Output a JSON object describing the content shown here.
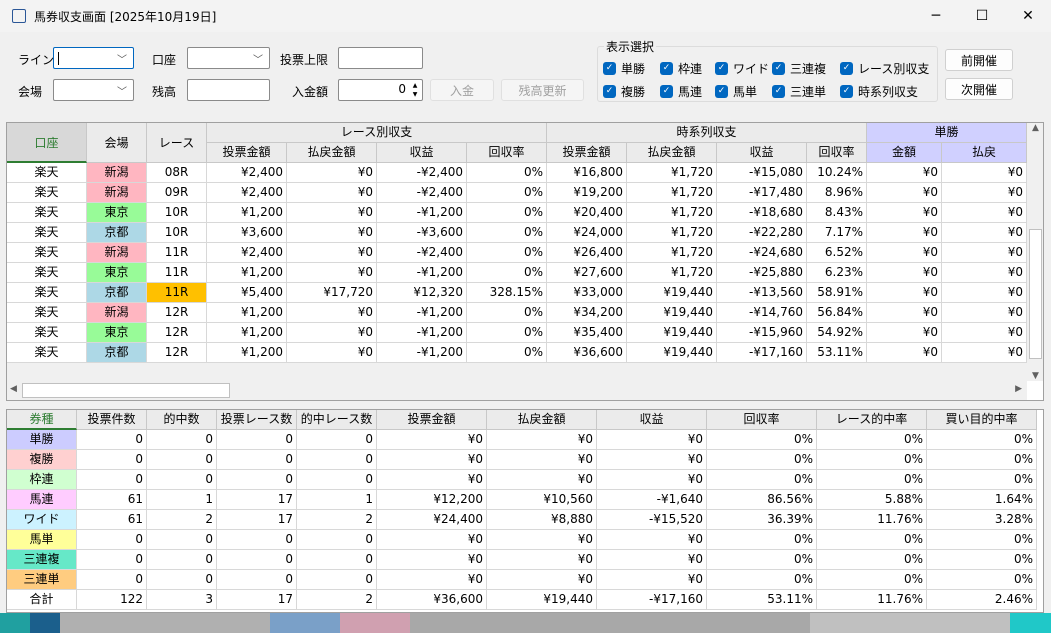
{
  "window": {
    "title": "馬券収支画面 [2025年10月19日]",
    "minimize": "─",
    "maximize": "☐",
    "close": "✕"
  },
  "form": {
    "line_label": "ライン",
    "line_value": "",
    "account_label": "口座",
    "account_value": "",
    "limit_label": "投票上限",
    "limit_value": "",
    "venue_label": "会場",
    "venue_value": "",
    "balance_label": "残高",
    "balance_value": "",
    "deposit_label": "入金額",
    "deposit_value": "0",
    "deposit_button": "入金",
    "update_balance_button": "残高更新",
    "prev_button": "前開催",
    "next_button": "次開催"
  },
  "display_select": {
    "title": "表示選択",
    "options": [
      {
        "label": "単勝",
        "checked": true
      },
      {
        "label": "枠連",
        "checked": true
      },
      {
        "label": "ワイド",
        "checked": true
      },
      {
        "label": "三連複",
        "checked": true
      },
      {
        "label": "レース別収支",
        "checked": true
      },
      {
        "label": "複勝",
        "checked": true
      },
      {
        "label": "馬連",
        "checked": true
      },
      {
        "label": "馬単",
        "checked": true
      },
      {
        "label": "三連単",
        "checked": true
      },
      {
        "label": "時系列収支",
        "checked": true
      }
    ]
  },
  "race_grid": {
    "group_headers": [
      "レース別収支",
      "時系列収支",
      "単勝"
    ],
    "headers": [
      "口座",
      "会場",
      "レース",
      "投票金額",
      "払戻金額",
      "収益",
      "回収率",
      "投票金額",
      "払戻金額",
      "収益",
      "回収率",
      "金額",
      "払戻"
    ],
    "venue_colors": {
      "新潟": "#ffb6c1",
      "東京": "#98fb98",
      "京都": "#add8e6"
    },
    "highlight_color": "#ffc000",
    "rows": [
      {
        "cells": [
          "楽天",
          "新潟",
          "08R",
          "¥2,400",
          "¥0",
          "-¥2,400",
          "0%",
          "¥16,800",
          "¥1,720",
          "-¥15,080",
          "10.24%",
          "¥0",
          "¥0"
        ]
      },
      {
        "cells": [
          "楽天",
          "新潟",
          "09R",
          "¥2,400",
          "¥0",
          "-¥2,400",
          "0%",
          "¥19,200",
          "¥1,720",
          "-¥17,480",
          "8.96%",
          "¥0",
          "¥0"
        ]
      },
      {
        "cells": [
          "楽天",
          "東京",
          "10R",
          "¥1,200",
          "¥0",
          "-¥1,200",
          "0%",
          "¥20,400",
          "¥1,720",
          "-¥18,680",
          "8.43%",
          "¥0",
          "¥0"
        ]
      },
      {
        "cells": [
          "楽天",
          "京都",
          "10R",
          "¥3,600",
          "¥0",
          "-¥3,600",
          "0%",
          "¥24,000",
          "¥1,720",
          "-¥22,280",
          "7.17%",
          "¥0",
          "¥0"
        ]
      },
      {
        "cells": [
          "楽天",
          "新潟",
          "11R",
          "¥2,400",
          "¥0",
          "-¥2,400",
          "0%",
          "¥26,400",
          "¥1,720",
          "-¥24,680",
          "6.52%",
          "¥0",
          "¥0"
        ]
      },
      {
        "cells": [
          "楽天",
          "東京",
          "11R",
          "¥1,200",
          "¥0",
          "-¥1,200",
          "0%",
          "¥27,600",
          "¥1,720",
          "-¥25,880",
          "6.23%",
          "¥0",
          "¥0"
        ]
      },
      {
        "cells": [
          "楽天",
          "京都",
          "11R",
          "¥5,400",
          "¥17,720",
          "¥12,320",
          "328.15%",
          "¥33,000",
          "¥19,440",
          "-¥13,560",
          "58.91%",
          "¥0",
          "¥0"
        ],
        "hit": true
      },
      {
        "cells": [
          "楽天",
          "新潟",
          "12R",
          "¥1,200",
          "¥0",
          "-¥1,200",
          "0%",
          "¥34,200",
          "¥19,440",
          "-¥14,760",
          "56.84%",
          "¥0",
          "¥0"
        ]
      },
      {
        "cells": [
          "楽天",
          "東京",
          "12R",
          "¥1,200",
          "¥0",
          "-¥1,200",
          "0%",
          "¥35,400",
          "¥19,440",
          "-¥15,960",
          "54.92%",
          "¥0",
          "¥0"
        ]
      },
      {
        "cells": [
          "楽天",
          "京都",
          "12R",
          "¥1,200",
          "¥0",
          "-¥1,200",
          "0%",
          "¥36,600",
          "¥19,440",
          "-¥17,160",
          "53.11%",
          "¥0",
          "¥0"
        ]
      }
    ]
  },
  "summary_grid": {
    "headers": [
      "券種",
      "投票件数",
      "的中数",
      "投票レース数",
      "的中レース数",
      "投票金額",
      "払戻金額",
      "収益",
      "回収率",
      "レース的中率",
      "買い目的中率"
    ],
    "rows": [
      {
        "color": "#ccccff",
        "cells": [
          "単勝",
          "0",
          "0",
          "0",
          "0",
          "¥0",
          "¥0",
          "¥0",
          "0%",
          "0%",
          "0%"
        ]
      },
      {
        "color": "#ffd0d0",
        "cells": [
          "複勝",
          "0",
          "0",
          "0",
          "0",
          "¥0",
          "¥0",
          "¥0",
          "0%",
          "0%",
          "0%"
        ]
      },
      {
        "color": "#d0ffd0",
        "cells": [
          "枠連",
          "0",
          "0",
          "0",
          "0",
          "¥0",
          "¥0",
          "¥0",
          "0%",
          "0%",
          "0%"
        ]
      },
      {
        "color": "#ffccff",
        "cells": [
          "馬連",
          "61",
          "1",
          "17",
          "1",
          "¥12,200",
          "¥10,560",
          "-¥1,640",
          "86.56%",
          "5.88%",
          "1.64%"
        ]
      },
      {
        "color": "#ccf2ff",
        "cells": [
          "ワイド",
          "61",
          "2",
          "17",
          "2",
          "¥24,400",
          "¥8,880",
          "-¥15,520",
          "36.39%",
          "11.76%",
          "3.28%"
        ]
      },
      {
        "color": "#ffff99",
        "cells": [
          "馬単",
          "0",
          "0",
          "0",
          "0",
          "¥0",
          "¥0",
          "¥0",
          "0%",
          "0%",
          "0%"
        ]
      },
      {
        "color": "#66e8c8",
        "cells": [
          "三連複",
          "0",
          "0",
          "0",
          "0",
          "¥0",
          "¥0",
          "¥0",
          "0%",
          "0%",
          "0%"
        ]
      },
      {
        "color": "#ffcc80",
        "cells": [
          "三連単",
          "0",
          "0",
          "0",
          "0",
          "¥0",
          "¥0",
          "¥0",
          "0%",
          "0%",
          "0%"
        ]
      },
      {
        "color": "#ffffff",
        "cells": [
          "合計",
          "122",
          "3",
          "17",
          "2",
          "¥36,600",
          "¥19,440",
          "-¥17,160",
          "53.11%",
          "11.76%",
          "2.46%"
        ]
      }
    ]
  }
}
